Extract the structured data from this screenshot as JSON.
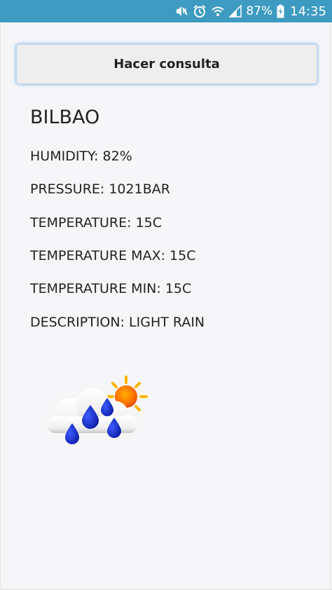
{
  "status_bar": {
    "battery": "87%",
    "time": "14:35",
    "icons": [
      "mute-vibrate-icon",
      "alarm-icon",
      "wifi-icon",
      "signal-icon",
      "battery-charging-icon"
    ],
    "background_color": "#3d9bc1"
  },
  "main": {
    "query_button_label": "Hacer consulta",
    "city": "BILBAO",
    "humidity": "HUMIDITY: 82%",
    "pressure": "PRESSURE: 1021BAR",
    "temperature": "TEMPERATURE: 15C",
    "temperature_max": "TEMPERATURE MAX: 15C",
    "temperature_min": "TEMPERATURE MIN: 15C",
    "description": "DESCRIPTION: LIGHT RAIN",
    "weather_icon": "light-rain-icon"
  }
}
